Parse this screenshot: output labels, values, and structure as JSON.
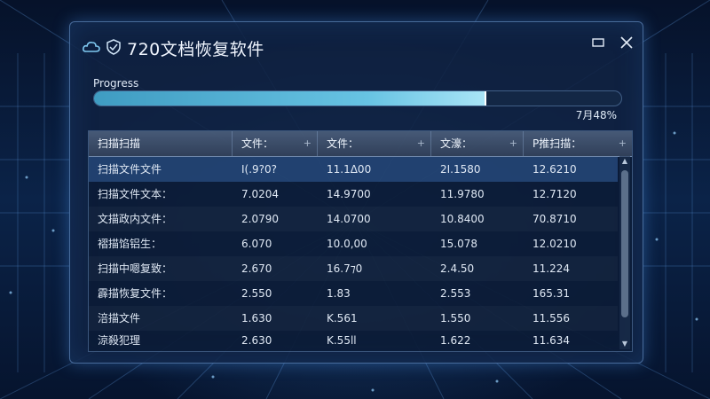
{
  "app": {
    "title": "720文档恢复软件"
  },
  "progress": {
    "label": "Progress",
    "text": "7月48%",
    "fraction": 0.74
  },
  "table": {
    "headers": [
      "扫描扫描",
      "文件：",
      "文件：",
      "文濠：",
      "P推扫描："
    ],
    "rows": [
      [
        "扫描文件文件",
        "I(.9?0?",
        "11.1Δ00",
        "2I.1580",
        "12.6210"
      ],
      [
        "扫描文件文本：",
        "7.0204",
        "14.9700",
        "11.9780",
        "12.7120"
      ],
      [
        "文描政内文件：",
        "2.0790",
        "14.0700",
        "10.8400",
        "70.8710"
      ],
      [
        "褶描馅铝生：",
        "6.070",
        "10.0,00",
        "15.078",
        "12.0210"
      ],
      [
        "扫描中嗯复致：",
        "2.670",
        "16.7⁊0",
        "2.4.50",
        "11.224"
      ],
      [
        "霹描恢复文件：",
        "2.550",
        "1.83",
        "2.553",
        "165.31"
      ],
      [
        "涪描文件",
        "1.630",
        "K.561",
        "1.550",
        "11.556"
      ],
      [
        "涼殺犯理",
        "2.630",
        "K.55ll",
        "1.622",
        "11.634"
      ]
    ]
  },
  "colors": {
    "accent": "#67c3e3",
    "window": "#102242",
    "selected": "#3c6eb4"
  }
}
